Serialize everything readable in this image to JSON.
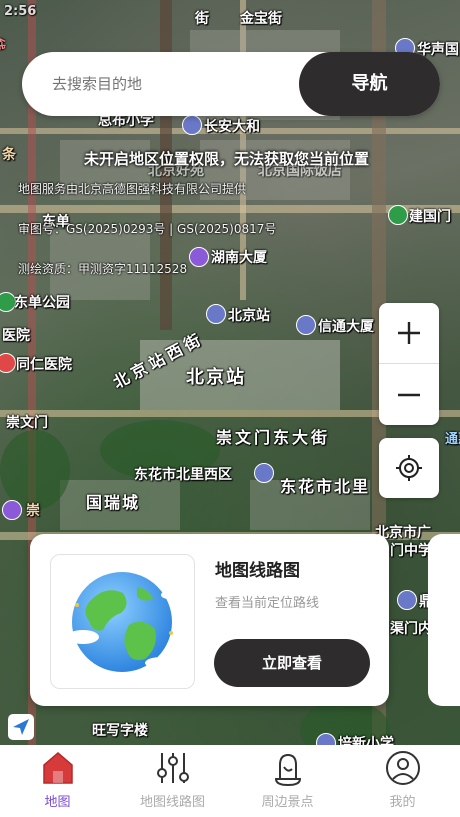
{
  "search": {
    "placeholder": "去搜索目的地",
    "nav_label": "导航"
  },
  "notice": "未开启地区位置权限，无法获取您当前位置",
  "credits": {
    "line1": "地图服务由北京高德图强科技有限公司提供",
    "line2": "审图号：GS(2025)0293号 | GS(2025)0817号",
    "line3": "测绘资质：甲测资字11112528"
  },
  "map_labels": {
    "jiejin": "街",
    "jinbao": "金宝街",
    "huasheng": "华声国",
    "zongbu": "总布小学",
    "changan": "长安大和",
    "guoji": "北京国际饭店",
    "haoyuan": "北京好苑",
    "dongdan": "东单",
    "jianguomen": "建国门",
    "hunan": "湖南大厦",
    "dongdan_park": "东单公园",
    "beijingzhan_poi": "北京站",
    "xintong": "信通大厦",
    "yiyuan": "医院",
    "tongren": "同仁医院",
    "station": "北京站",
    "road_west": "北京站西街",
    "chongwenmen": "崇文门",
    "chongwenmen_east": "崇文门东大街",
    "dongli": "东花市北里西区",
    "dongli2": "东花市北里",
    "guorui": "国瑞城",
    "beijingguang": "北京市广",
    "menzhong": "门中学",
    "jing": "鼎",
    "menwai": "渠门内",
    "wangwang": "旺写字楼",
    "jieyou": "培新小学",
    "chong": "崇",
    "xian": "线",
    "tiao": "条",
    "hui": "通惠",
    "time": "2:56"
  },
  "card": {
    "title": "地图线路图",
    "subtitle": "查看当前定位路线",
    "button": "立即查看"
  },
  "tabs": [
    {
      "label": "地图",
      "icon": "house-icon",
      "active": true
    },
    {
      "label": "地图线路图",
      "icon": "sliders-icon",
      "active": false
    },
    {
      "label": "周边景点",
      "icon": "bell-pin-icon",
      "active": false
    },
    {
      "label": "我的",
      "icon": "user-icon",
      "active": false
    }
  ],
  "colors": {
    "accent": "#d63a3a",
    "active_label": "#7a4bd6",
    "dark_button": "#2e2c2c"
  }
}
